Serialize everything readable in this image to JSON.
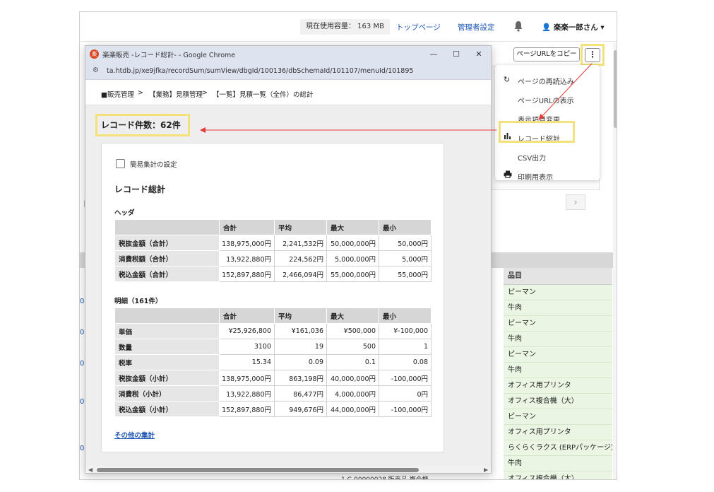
{
  "header": {
    "usage": "現在使用容量： 163 MB",
    "top_page": "トップページ",
    "admin_settings": "管理者設定",
    "user_name": "楽楽一郎さん"
  },
  "toolbar": {
    "copy_url": "ページURLをコピー",
    "more": "⋮"
  },
  "menu": {
    "items": [
      {
        "label": "ページの再読込み",
        "icon": "refresh-icon"
      },
      {
        "label": "ページURLの表示",
        "icon": ""
      },
      {
        "label": "表示項目変更",
        "icon": ""
      },
      {
        "label": "レコード総計",
        "icon": "bar-chart-icon"
      },
      {
        "label": "CSV出力",
        "icon": ""
      },
      {
        "label": "印刷用表示",
        "icon": "printer-icon"
      }
    ]
  },
  "background_list": {
    "column_header": "品目",
    "rows": [
      "ピーマン",
      "牛肉",
      "ピーマン",
      "牛肉",
      "ピーマン",
      "牛肉",
      "オフィス用プリンタ",
      "オフィス複合機（大）",
      "ピーマン",
      "オフィス用プリンタ",
      "らくらくラクス (ERPパッケージ)",
      "牛肉"
    ],
    "left_fragment": "【一",
    "link_fragment": "00(",
    "bottom_fragment": "1  C-00000028  販売品  複合機",
    "bottom_row_item": "オフィス複合機（大）"
  },
  "popup": {
    "window_title": "楽楽販売 -レコード総計- - Google Chrome",
    "url": "ta.htdb.jp/xe9jfka/recordSum/sumView/dbgId/100136/dbSchemaId/101107/menuId/101895",
    "breadcrumb": [
      "■販売管理",
      "【業務】見積管理",
      "【一覧】見積一覧（全件）の総計"
    ],
    "breadcrumb_sep": ">",
    "record_count": "レコード件数：62件",
    "simple_agg_label": "簡易集計の設定",
    "card_title": "レコード総計",
    "header_section": {
      "title": "ヘッダ",
      "columns": [
        "",
        "合計",
        "平均",
        "最大",
        "最小"
      ],
      "rows": [
        [
          "税抜金額（合計）",
          "138,975,000円",
          "2,241,532円",
          "50,000,000円",
          "50,000円"
        ],
        [
          "消費税額（合計）",
          "13,922,880円",
          "224,562円",
          "5,000,000円",
          "5,000円"
        ],
        [
          "税込金額（合計）",
          "152,897,880円",
          "2,466,094円",
          "55,000,000円",
          "55,000円"
        ]
      ]
    },
    "detail_section": {
      "title": "明細（161件）",
      "columns": [
        "",
        "合計",
        "平均",
        "最大",
        "最小"
      ],
      "rows": [
        [
          "単価",
          "¥25,926,800",
          "¥161,036",
          "¥500,000",
          "¥-100,000"
        ],
        [
          "数量",
          "3100",
          "19",
          "500",
          "1"
        ],
        [
          "税率",
          "15.34",
          "0.09",
          "0.1",
          "0.08"
        ],
        [
          "税抜金額（小計）",
          "138,975,000円",
          "863,198円",
          "40,000,000円",
          "-100,000円"
        ],
        [
          "消費税（小計）",
          "13,922,880円",
          "86,477円",
          "4,000,000円",
          "0円"
        ],
        [
          "税込金額（小計）",
          "152,897,880円",
          "949,676円",
          "44,000,000円",
          "-100,000円"
        ]
      ]
    },
    "other_agg_link": "その他の集計"
  },
  "colors": {
    "highlight": "#f3e27a",
    "arrow": "#e53935",
    "link": "#1a55b3",
    "row_green": "#eaf6e3"
  }
}
